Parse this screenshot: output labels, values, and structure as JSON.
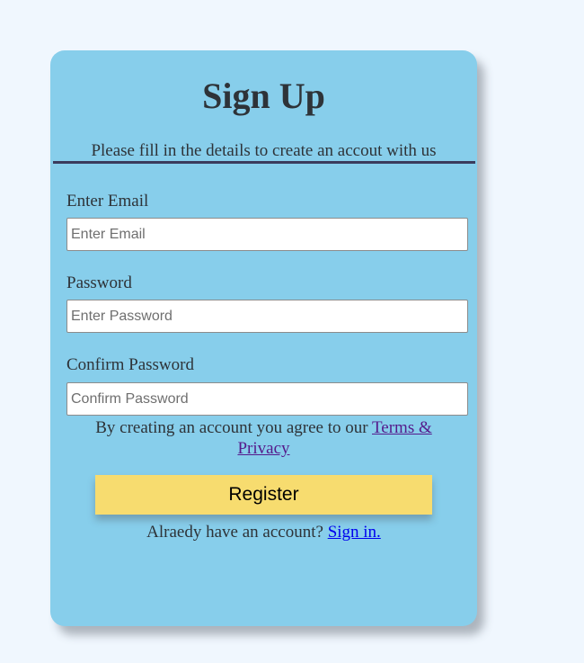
{
  "form": {
    "title": "Sign Up",
    "subtitle": "Please fill in the details to create an accout with us",
    "email": {
      "label": "Enter Email",
      "placeholder": "Enter Email",
      "value": ""
    },
    "password": {
      "label": "Password",
      "placeholder": "Enter Password",
      "value": ""
    },
    "confirm_password": {
      "label": "Confirm Password",
      "placeholder": "Confirm Password",
      "value": ""
    },
    "terms": {
      "text": "By creating an account you agree to our ",
      "link_label": "Terms & Privacy"
    },
    "register_label": "Register",
    "signin": {
      "text": "Alraedy have an account? ",
      "link_label": "Sign in."
    }
  },
  "colors": {
    "page_background": "#f0f7fe",
    "card_background": "#87ceeb",
    "button_background": "#f7dc6f",
    "divider": "#3b3b5c",
    "visited_link": "#551a8b",
    "link": "#0000ee"
  }
}
